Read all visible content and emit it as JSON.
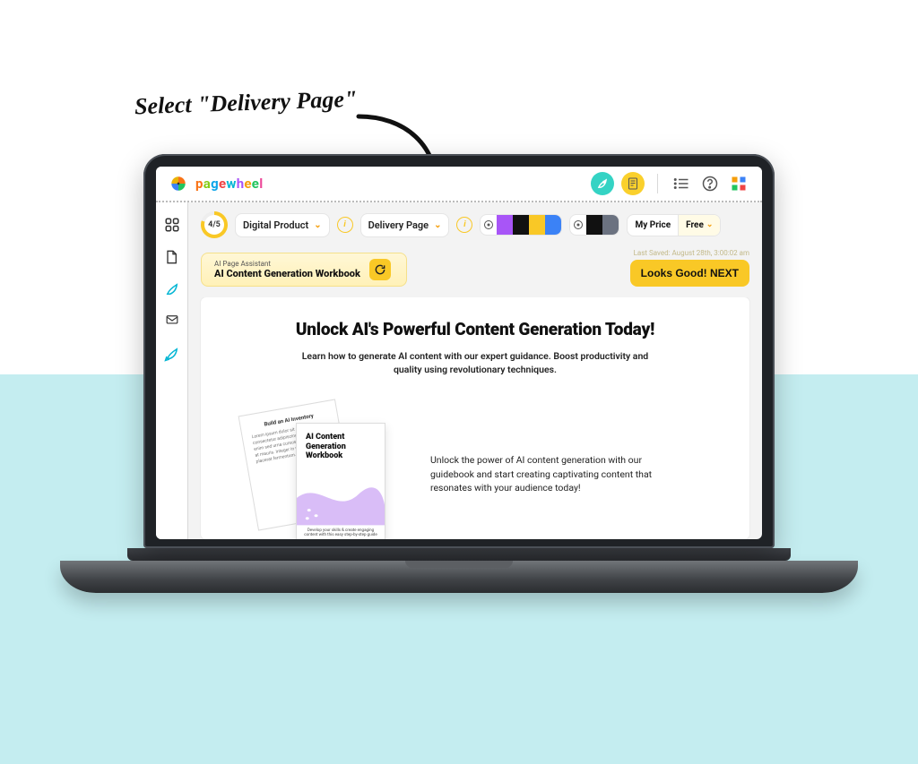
{
  "annotation": {
    "text": "Select \"Delivery Page\""
  },
  "brand": {
    "name": "pagewheel"
  },
  "header": {
    "boost_icon": "rocket",
    "doc_icon": "document",
    "list_icon": "list",
    "help_icon": "help",
    "apps_icon": "apps"
  },
  "sidebar": {
    "items": [
      {
        "name": "dashboard-icon"
      },
      {
        "name": "page-icon"
      },
      {
        "name": "launch-icon"
      },
      {
        "name": "mail-icon"
      },
      {
        "name": "publish-icon"
      }
    ]
  },
  "toolbar": {
    "progress": "4/5",
    "product_type": "Digital Product",
    "page_type": "Delivery Page",
    "palette_a": [
      "#a855f7",
      "#111111",
      "#f9c826",
      "#3b82f6"
    ],
    "palette_b": [
      "#111111",
      "#6b7280"
    ],
    "price_label": "My Price",
    "price_value": "Free"
  },
  "assistant": {
    "label": "AI Page Assistant",
    "title": "AI Content Generation Workbook",
    "last_saved": "Last Saved: August 28th, 3:00:02 am",
    "next_label": "Looks Good! NEXT"
  },
  "hero": {
    "title": "Unlock AI's Powerful Content Generation Today!",
    "subtitle": "Learn how to generate AI content with our expert guidance. Boost productivity and quality using revolutionary techniques.",
    "mockup": {
      "back_title": "Build an AI Inventory",
      "back_lines": "Lorem ipsum dolor sit amet, consectetur adipiscing elit. Nulla at enim sed urna cursus bibendum vitae at mauris. Integer in velit id orci placerat fermentum.",
      "front_title": "AI Content Generation Workbook",
      "front_footer": "Develop your skills & create engaging content with this easy step-by-step guide"
    },
    "copy": "Unlock the power of AI content generation with our guidebook and start creating captivating content that resonates with your audience today!"
  },
  "colors": {
    "wave": "#c9a8f5"
  }
}
